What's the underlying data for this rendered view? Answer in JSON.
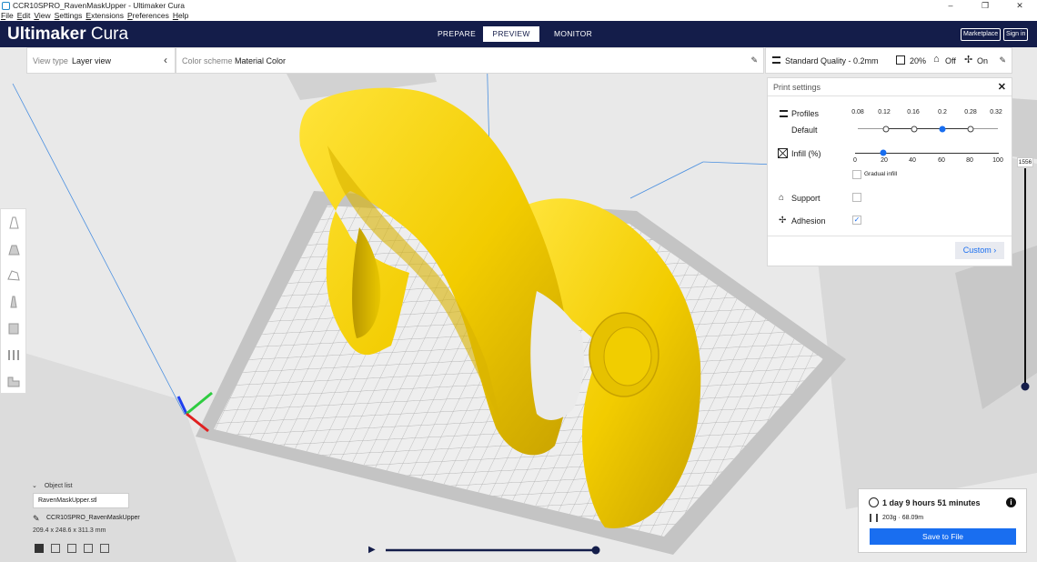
{
  "window": {
    "title": "CCR10SPRO_RavenMaskUpper - Ultimaker Cura",
    "controls": [
      "–",
      "❐",
      "✕"
    ]
  },
  "menu": [
    "File",
    "Edit",
    "View",
    "Settings",
    "Extensions",
    "Preferences",
    "Help"
  ],
  "header": {
    "logo_bold": "Ultimaker",
    "logo_light": " Cura",
    "tabs": [
      "PREPARE",
      "PREVIEW",
      "MONITOR"
    ],
    "active_tab": "PREVIEW",
    "marketplace": "Marketplace",
    "sign_in": "Sign in",
    "colors": {
      "header_bg": "#141d4a",
      "accent": "#196ef0",
      "model": "#f5d100"
    }
  },
  "view_type": {
    "label": "View type",
    "value": "Layer view"
  },
  "color_scheme": {
    "label": "Color scheme",
    "value": "Material Color"
  },
  "quality_bar": {
    "profile": "Standard Quality - 0.2mm",
    "infill": "20%",
    "support": "Off",
    "adhesion": "On"
  },
  "print_settings": {
    "title": "Print settings",
    "profiles_label": "Profiles",
    "profile_name": "Default",
    "layer_heights": [
      "0.08",
      "0.12",
      "0.16",
      "0.2",
      "0.28",
      "0.32"
    ],
    "selected_layer_height": "0.2",
    "infill_label": "Infill (%)",
    "infill_ticks": [
      "0",
      "20",
      "40",
      "60",
      "80",
      "100"
    ],
    "infill_value": 20,
    "gradual_infill": "Gradual infill",
    "support_label": "Support",
    "support_checked": false,
    "adhesion_label": "Adhesion",
    "adhesion_checked": true,
    "custom_button": "Custom"
  },
  "layer_slider": {
    "value": "1556"
  },
  "object_list": {
    "header": "Object list",
    "file": "RavenMaskUpper.stl",
    "job_name": "CCR10SPRO_RavenMaskUpper",
    "dimensions": "209.4 x 248.6 x 311.3 mm"
  },
  "summary": {
    "time": "1 day 9 hours 51 minutes",
    "material": "203g · 68.09m",
    "save_button": "Save to File"
  }
}
